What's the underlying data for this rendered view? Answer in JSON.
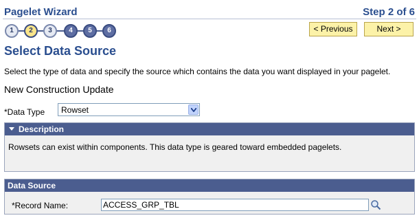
{
  "header": {
    "wizard_title": "Pagelet Wizard",
    "step_indicator": "Step 2 of 6"
  },
  "steps": [
    {
      "label": "1",
      "state": "done"
    },
    {
      "label": "2",
      "state": "current"
    },
    {
      "label": "3",
      "state": "done"
    },
    {
      "label": "4",
      "state": "future"
    },
    {
      "label": "5",
      "state": "future"
    },
    {
      "label": "6",
      "state": "future"
    }
  ],
  "nav": {
    "previous_label": "< Previous",
    "next_label": "Next >"
  },
  "page": {
    "title": "Select Data Source",
    "instructions": "Select the type of data and specify the source which contains the data you want displayed in your pagelet.",
    "pagelet_name": "New Construction Update"
  },
  "data_type": {
    "label": "*Data Type",
    "selected": "Rowset"
  },
  "description": {
    "header": "Description",
    "text": "Rowsets can exist within components.  This data type is geared toward embedded pagelets."
  },
  "data_source": {
    "header": "Data Source",
    "record_label": "*Record Name:",
    "record_value": "ACCESS_GRP_TBL"
  },
  "colors": {
    "title_blue": "#2a4e8f",
    "panel_header": "#4b5d8f",
    "button_yellow": "#fcf2a8",
    "current_step": "#fbe58a"
  },
  "icons": {
    "collapse": "triangle-down-icon",
    "lookup": "magnifier-icon",
    "dropdown": "chevron-down-icon"
  }
}
